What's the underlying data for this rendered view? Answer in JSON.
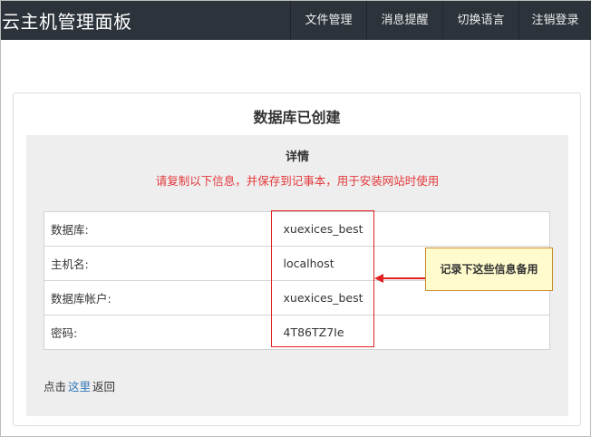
{
  "navbar": {
    "brand": "云主机管理面板",
    "items": [
      "文件管理",
      "消息提醒",
      "切换语言",
      "注销登录"
    ]
  },
  "panel": {
    "title": "数据库已创建",
    "detail_title": "详情",
    "warning": "请复制以下信息，并保存到记事本，用于安装网站时使用",
    "rows": [
      {
        "key": "数据库:",
        "value": "xuexices_best"
      },
      {
        "key": "主机名:",
        "value": "localhost"
      },
      {
        "key": "数据库帐户:",
        "value": "xuexices_best"
      },
      {
        "key": "密码:",
        "value": "4T86TZ7Ie"
      }
    ],
    "footer_prefix": "点击",
    "footer_link": "这里",
    "footer_suffix": "返回"
  },
  "annotation": {
    "callout": "记录下这些信息备用",
    "color": "#e02020"
  }
}
